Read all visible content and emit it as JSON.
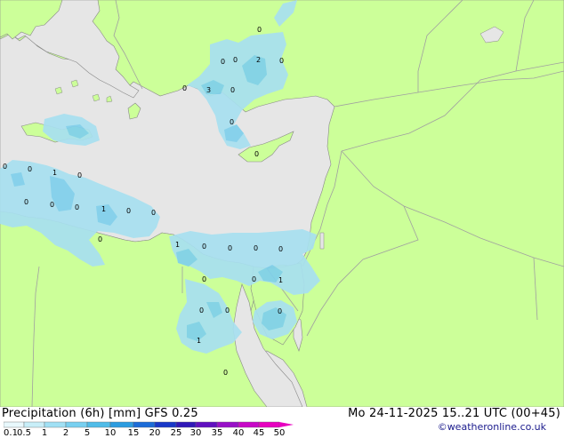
{
  "title": "Precipitation (6h) [mm] GFS 0.25",
  "valid_time": "Mo 24-11-2025 15..21 UTC (00+45)",
  "credit": "©weatheronline.co.uk",
  "colors": {
    "land": "#ccff99",
    "sea": "#e6e6e6",
    "border": "#a0a0a0",
    "coast": "#888888",
    "precip_light": "#a8e0f0",
    "precip_mid": "#7fd0ec",
    "precip_heavy": "#5abce0"
  },
  "legend": {
    "ticks": [
      "0.1",
      "0.5",
      "1",
      "2",
      "5",
      "10",
      "15",
      "20",
      "25",
      "30",
      "35",
      "40",
      "45",
      "50"
    ],
    "colors": [
      "#e8f8fc",
      "#c8eef8",
      "#a0e0f4",
      "#78d0f0",
      "#50bce8",
      "#2c9ce0",
      "#1c6cd8",
      "#1838c8",
      "#3018b8",
      "#6010c0",
      "#9810c8",
      "#c808c8",
      "#e800c0"
    ]
  },
  "labels": [
    {
      "id": "a1",
      "text": "0"
    },
    {
      "id": "a2",
      "text": "0"
    },
    {
      "id": "a3",
      "text": "0"
    },
    {
      "id": "a4",
      "text": "2"
    },
    {
      "id": "a5",
      "text": "0"
    },
    {
      "id": "a6",
      "text": "0"
    },
    {
      "id": "a7",
      "text": "3"
    },
    {
      "id": "a8",
      "text": "0"
    },
    {
      "id": "a9",
      "text": "0"
    },
    {
      "id": "a10",
      "text": "0"
    },
    {
      "id": "a11",
      "text": "0"
    },
    {
      "id": "a12",
      "text": "0"
    },
    {
      "id": "a13",
      "text": "1"
    },
    {
      "id": "a14",
      "text": "0"
    },
    {
      "id": "a15",
      "text": "0"
    },
    {
      "id": "a16",
      "text": "0"
    },
    {
      "id": "a17",
      "text": "0"
    },
    {
      "id": "a18",
      "text": "1"
    },
    {
      "id": "a19",
      "text": "0"
    },
    {
      "id": "a20",
      "text": "0"
    },
    {
      "id": "a21",
      "text": "0"
    },
    {
      "id": "a22",
      "text": "1"
    },
    {
      "id": "a23",
      "text": "0"
    },
    {
      "id": "a24",
      "text": "0"
    },
    {
      "id": "a25",
      "text": "0"
    },
    {
      "id": "a26",
      "text": "0"
    },
    {
      "id": "a27",
      "text": "0"
    },
    {
      "id": "a28",
      "text": "0"
    },
    {
      "id": "a29",
      "text": "1"
    },
    {
      "id": "a30",
      "text": "0"
    },
    {
      "id": "a31",
      "text": "0"
    },
    {
      "id": "a32",
      "text": "0"
    },
    {
      "id": "a33",
      "text": "1"
    },
    {
      "id": "a34",
      "text": "0"
    }
  ]
}
